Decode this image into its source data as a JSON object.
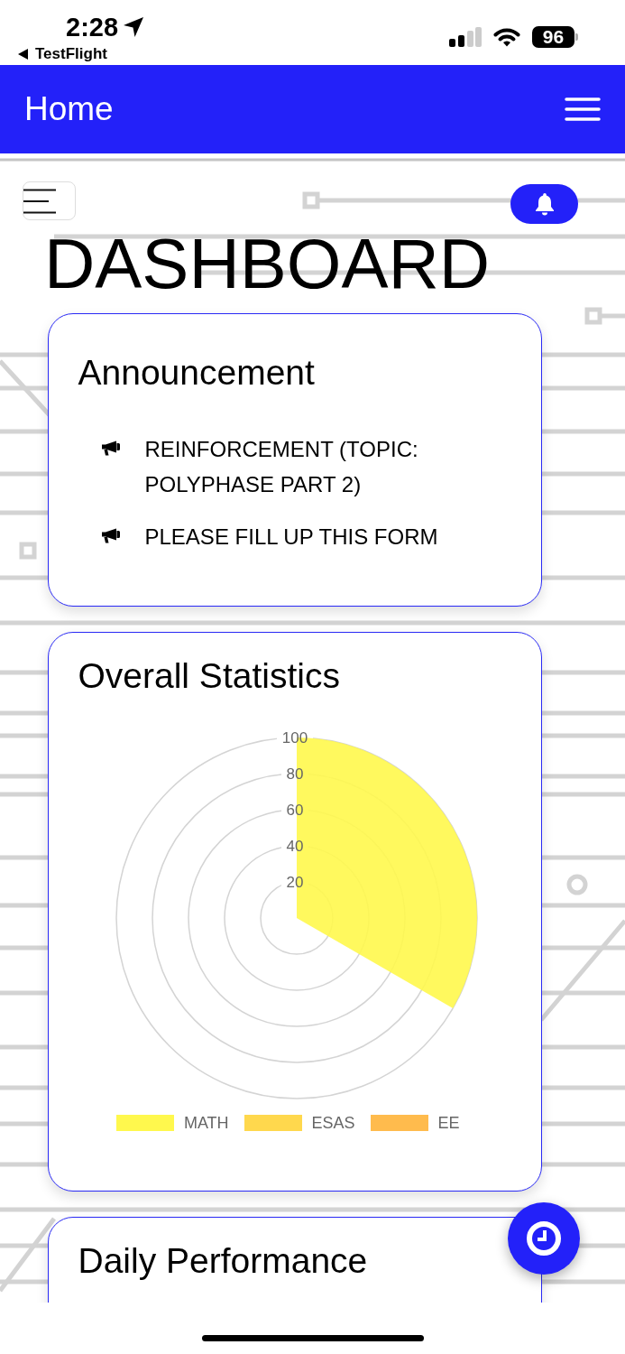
{
  "status_bar": {
    "time": "2:28",
    "back_label": "TestFlight",
    "battery": "96"
  },
  "nav_bar": {
    "title": "Home"
  },
  "page": {
    "heading": "DASHBOARD"
  },
  "announcement": {
    "title": "Announcement",
    "items": [
      "REINFORCEMENT (TOPIC: POLYPHASE PART 2)",
      "PLEASE FILL UP THIS FORM"
    ]
  },
  "statistics": {
    "title": "Overall Statistics",
    "radial_ticks": [
      "100",
      "80",
      "60",
      "40",
      "20"
    ],
    "chart_data": {
      "type": "pie",
      "series": [
        {
          "color": "#fff84d",
          "values": [
            100
          ]
        }
      ]
    },
    "legend": [
      {
        "label": "MATH",
        "color": "#fff84d"
      },
      {
        "label": "ESAS",
        "color": "#ffd84d"
      },
      {
        "label": "EE",
        "color": "#ffbb4d"
      }
    ]
  },
  "daily_performance": {
    "title": "Daily Performance"
  }
}
